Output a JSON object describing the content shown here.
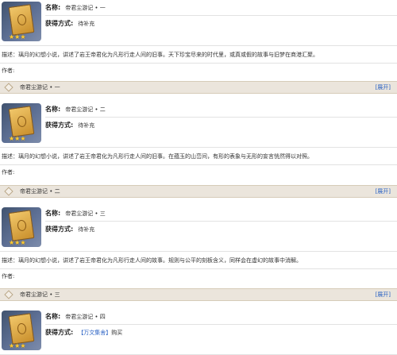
{
  "labels": {
    "name": "名称:",
    "method": "获得方式:",
    "author": "作者:",
    "expand": "[展开]"
  },
  "entries": [
    {
      "title": "帝君尘游记 • 一",
      "name_value": "帝君尘游记 • 一",
      "method_value": "待补充",
      "description": "描述：璃月的幻想小说，讲述了岩王帝君化为凡形行走人间的旧事。天下珍宝尽来的时代里，或真或假的故事与旧梦在商港汇聚。",
      "author_value": ""
    },
    {
      "title": "帝君尘游记 • 二",
      "name_value": "帝君尘游记 • 二",
      "method_value": "待补充",
      "description": "描述：璃月的幻想小说，讲述了岩王帝君化为凡形行走人间的旧事。在蕴玉的山峦间，有形的表象与无形的妄言恍然得以对照。",
      "author_value": ""
    },
    {
      "title": "帝君尘游记 • 三",
      "name_value": "帝君尘游记 • 三",
      "method_value": "待补充",
      "description": "描述：璃月的幻想小说，讲述了岩王帝君化为凡形行走人间的故事。规则与公平的刻板含义，同样会在虚幻的故事中消解。",
      "author_value": ""
    },
    {
      "title": "帝君尘游记 • 四",
      "name_value": "帝君尘游记 • 四",
      "method_value_link": "【万文集舍】",
      "method_value_suffix": "购买"
    }
  ],
  "stars": "★★★",
  "icons": {
    "book": "book-icon",
    "stars": "star-icon"
  },
  "colors": {
    "link": "#2a62c4",
    "bar_bg": "#ebe5dc",
    "star": "#ffcc33"
  }
}
